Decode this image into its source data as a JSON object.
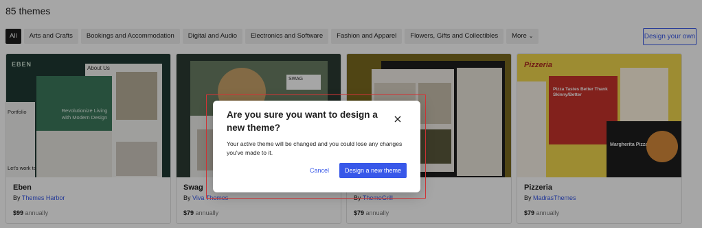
{
  "header": {
    "count": "85 themes"
  },
  "filters": [
    {
      "label": "All",
      "active": true
    },
    {
      "label": "Arts and Crafts"
    },
    {
      "label": "Bookings and Accommodation"
    },
    {
      "label": "Digital and Audio"
    },
    {
      "label": "Electronics and Software"
    },
    {
      "label": "Fashion and Apparel"
    },
    {
      "label": "Flowers, Gifts and Collectibles"
    },
    {
      "label": "More"
    }
  ],
  "design_own": "Design your own",
  "themes": [
    {
      "name": "Eben",
      "by": "By",
      "author": "Themes Harbor",
      "price": "$99",
      "period": "annually",
      "thumb": {
        "brand": "EBEN",
        "heading": "About Us",
        "tagline": "Revolutionize Living with Modern Design",
        "nav": "Portfolio",
        "footer": "Let's work to"
      }
    },
    {
      "name": "Swag",
      "by": "By",
      "author": "Viva Themes",
      "price": "$79",
      "period": "annually",
      "thumb": {
        "badge": "SWAG"
      }
    },
    {
      "name": "",
      "by": "By",
      "author": "ThemeGrill",
      "price": "$79",
      "period": "annually",
      "thumb": {}
    },
    {
      "name": "Pizzeria",
      "by": "By",
      "author": "MadrasThemes",
      "price": "$79",
      "period": "annually",
      "thumb": {
        "brand": "Pizzeria",
        "promo": "Pizza Tastes Better Thank Skinny/Better",
        "feature": "Margherita Pizza"
      }
    }
  ],
  "modal": {
    "title": "Are you sure you want to design a new theme?",
    "body": "Your active theme will be changed and you could lose any changes you've made to it.",
    "cancel": "Cancel",
    "confirm": "Design a new theme"
  }
}
